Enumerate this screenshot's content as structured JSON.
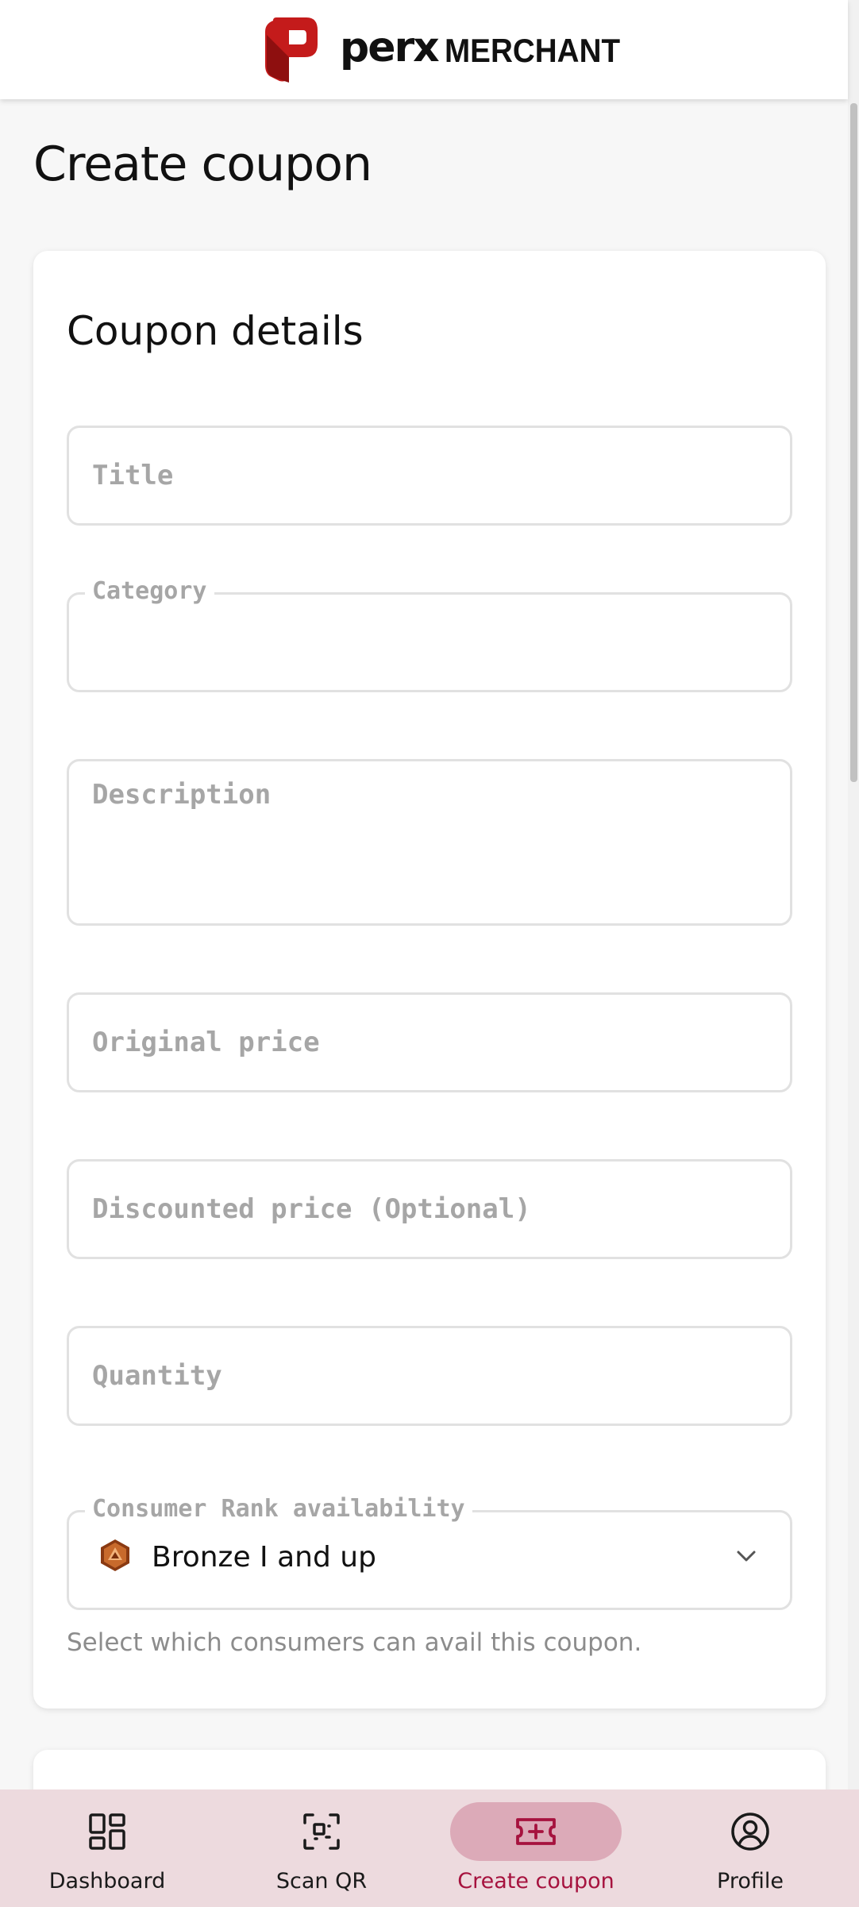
{
  "header": {
    "brand_primary": "perx",
    "brand_secondary": "MERCHANT",
    "logo_icon": "perx-logo-icon",
    "logo_color": "#c41b1b"
  },
  "page": {
    "title": "Create coupon"
  },
  "coupon_details": {
    "title": "Coupon details",
    "fields": {
      "title": {
        "placeholder": "Title",
        "value": ""
      },
      "category": {
        "label": "Category",
        "value": ""
      },
      "description": {
        "placeholder": "Description",
        "value": ""
      },
      "original_price": {
        "placeholder": "Original price",
        "value": ""
      },
      "discounted_price": {
        "placeholder": "Discounted price (Optional)",
        "value": ""
      },
      "quantity": {
        "placeholder": "Quantity",
        "value": ""
      },
      "rank": {
        "label": "Consumer Rank availability",
        "value": "Bronze I and up",
        "icon": "bronze-rank-icon",
        "helper": "Select which consumers can avail this coupon."
      }
    }
  },
  "bottom_nav": {
    "items": [
      {
        "label": "Dashboard",
        "icon": "dashboard-icon",
        "active": false
      },
      {
        "label": "Scan QR",
        "icon": "scan-qr-icon",
        "active": false
      },
      {
        "label": "Create coupon",
        "icon": "ticket-plus-icon",
        "active": true
      },
      {
        "label": "Profile",
        "icon": "profile-icon",
        "active": false
      }
    ],
    "active_color": "#a6123e",
    "background": "#eddade"
  }
}
